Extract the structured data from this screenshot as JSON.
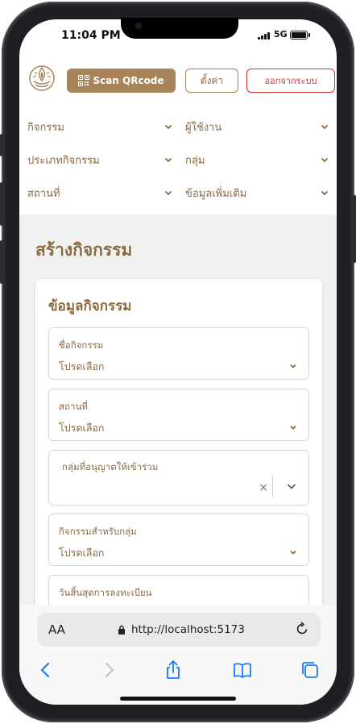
{
  "status": {
    "time": "11:04 PM",
    "network": "5G"
  },
  "header": {
    "scan_label": "Scan QRcode",
    "settings_label": "ตั้งค่า",
    "logout_label": "ออกจากระบบ"
  },
  "nav": {
    "items": [
      {
        "label": "กิจกรรม"
      },
      {
        "label": "ผู้ใช้งาน"
      },
      {
        "label": "ประเภทกิจกรรม"
      },
      {
        "label": "กลุ่ม"
      },
      {
        "label": "สถานที่"
      },
      {
        "label": "ข้อมูลเพิ่มเติม"
      }
    ]
  },
  "page": {
    "title": "สร้างกิจกรรม",
    "card_title": "ข้อมูลกิจกรรม",
    "fields": [
      {
        "label": "ชื่อกิจกรรม",
        "value": "โปรดเลือก"
      },
      {
        "label": "สถานที่",
        "value": "โปรดเลือก"
      },
      {
        "label": "กลุ่มที่อนุญาตให้เข้าร่วม",
        "value": ""
      },
      {
        "label": "กิจกรรมสำหรับกลุ่ม",
        "value": "โปรดเลือก"
      },
      {
        "label": "วันสิ้นสุดการลงทะเบียน",
        "value": ""
      }
    ],
    "clear_glyph": "×"
  },
  "browser": {
    "aa_label": "AA",
    "url": "http://localhost:5173"
  },
  "colors": {
    "brand": "#a7845a",
    "brand_text": "#8b6a40",
    "danger": "#d9302b",
    "page_bg": "#f1f1f1"
  }
}
